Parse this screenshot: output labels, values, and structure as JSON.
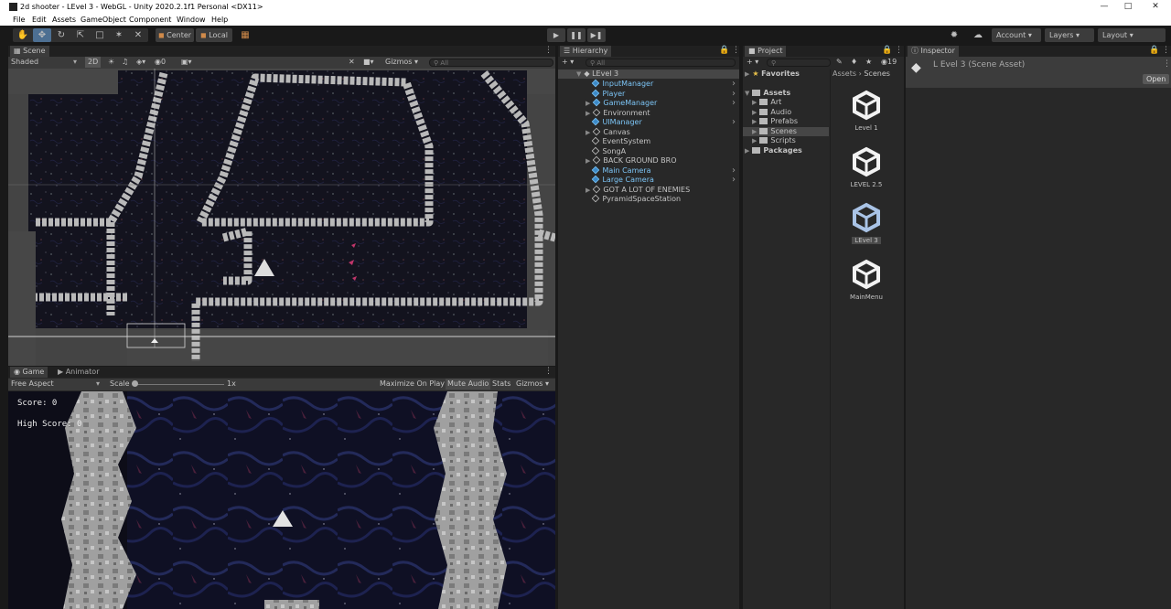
{
  "window": {
    "title": "2d shooter - LEvel 3 - WebGL - Unity 2020.2.1f1 Personal <DX11>"
  },
  "menu": [
    "File",
    "Edit",
    "Assets",
    "GameObject",
    "Component",
    "Window",
    "Help"
  ],
  "toolbar": {
    "pivot": "Center",
    "space": "Local",
    "account": "Account",
    "layers": "Layers",
    "layout": "Layout"
  },
  "scene": {
    "tab": "Scene",
    "shading": "Shaded",
    "mode2d": "2D",
    "hidden_count": "0",
    "gizmos": "Gizmos",
    "search_placeholder": "All"
  },
  "game": {
    "tab": "Game",
    "tab_animator": "Animator",
    "aspect": "Free Aspect",
    "scale_label": "Scale",
    "scale_value": "1x",
    "maximize": "Maximize On Play",
    "mute": "Mute Audio",
    "stats": "Stats",
    "gizmos": "Gizmos",
    "score": "Score: 0",
    "high_score": "High Score: 0"
  },
  "hierarchy": {
    "tab": "Hierarchy",
    "search_placeholder": "All",
    "root": "LEvel 3",
    "items": [
      {
        "label": "InputManager",
        "prefab": true,
        "expandable": false,
        "more": true
      },
      {
        "label": "Player",
        "prefab": true,
        "expandable": false,
        "more": true
      },
      {
        "label": "GameManager",
        "prefab": true,
        "expandable": true,
        "more": true
      },
      {
        "label": "Environment",
        "prefab": false,
        "expandable": true,
        "more": false
      },
      {
        "label": "UIManager",
        "prefab": true,
        "expandable": false,
        "more": true
      },
      {
        "label": "Canvas",
        "prefab": false,
        "expandable": true,
        "more": false
      },
      {
        "label": "EventSystem",
        "prefab": false,
        "expandable": false,
        "more": false
      },
      {
        "label": "SongA",
        "prefab": false,
        "expandable": false,
        "more": false
      },
      {
        "label": "BACK GROUND BRO",
        "prefab": false,
        "expandable": true,
        "more": false
      },
      {
        "label": "Main Camera",
        "prefab": true,
        "expandable": false,
        "more": true
      },
      {
        "label": "Large Camera",
        "prefab": true,
        "expandable": false,
        "more": true
      },
      {
        "label": "GOT A LOT OF ENEMIES",
        "prefab": false,
        "expandable": true,
        "more": false
      },
      {
        "label": "PyramidSpaceStation",
        "prefab": false,
        "expandable": false,
        "more": false
      }
    ]
  },
  "project": {
    "tab": "Project",
    "hidden_count": "19",
    "favorites": "Favorites",
    "assets": "Assets",
    "folders": [
      "Art",
      "Audio",
      "Prefabs",
      "Scenes",
      "Scripts"
    ],
    "packages": "Packages",
    "breadcrumb": [
      "Assets",
      "Scenes"
    ],
    "scenes": [
      "Level 1",
      "LEVEL 2.5",
      "LEvel 3",
      "MainMenu"
    ]
  },
  "inspector": {
    "tab": "Inspector",
    "asset_title": "L Evel 3 (Scene Asset)",
    "open": "Open"
  },
  "colors": {
    "accent_blue": "#7cc4f5",
    "panel_bg": "#282828",
    "selection": "#464646"
  }
}
